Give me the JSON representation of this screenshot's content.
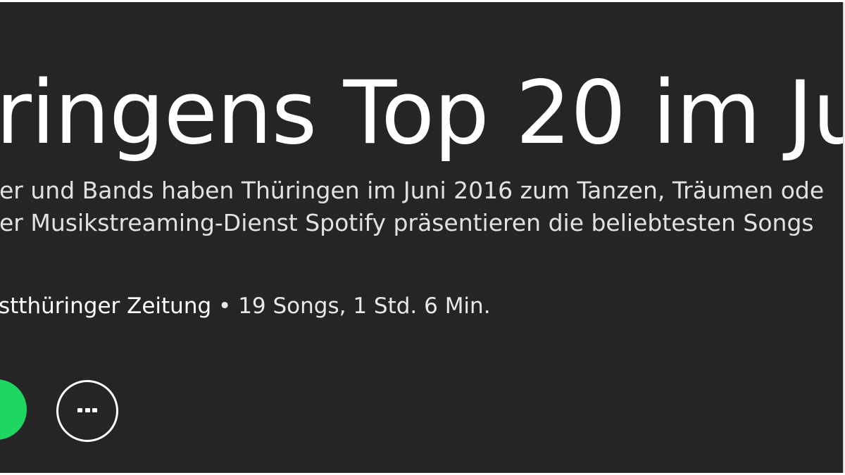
{
  "playlist": {
    "title": "ringens Top 20 im Ju",
    "description_lines": [
      "er und Bands haben Thüringen im Juni 2016 zum Tanzen, Träumen ode",
      "er Musikstreaming-Dienst Spotify präsentieren die beliebtesten Songs"
    ],
    "owner": "stthüringer Zeitung",
    "separator": "•",
    "stats": "19 Songs, 1 Std. 6 Min."
  },
  "controls": {
    "play_icon": "play-circle-icon",
    "more_icon": "more-dots-icon"
  },
  "colors": {
    "background": "#252525",
    "accent": "#1ed760",
    "text": "#ffffff"
  }
}
